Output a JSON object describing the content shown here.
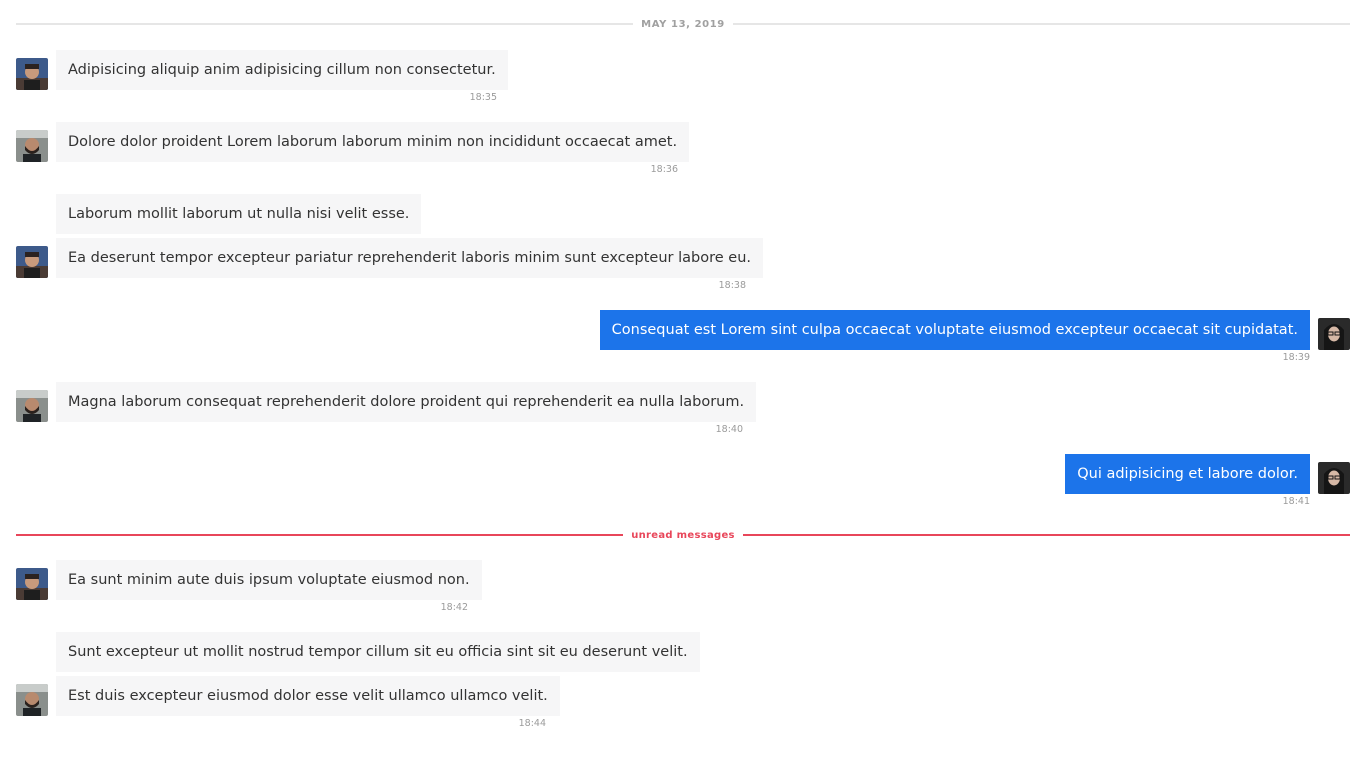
{
  "chat": {
    "date_divider": "MAY 13, 2019",
    "unread_divider": "unread messages",
    "messages": [
      {
        "text": "Adipisicing aliquip anim adipisicing cillum non consectetur.",
        "time": "18:35"
      },
      {
        "text": "Dolore dolor proident Lorem laborum laborum minim non incididunt occaecat amet.",
        "time": "18:36"
      },
      {
        "text": "Laborum mollit laborum ut nulla nisi velit esse."
      },
      {
        "text": "Ea deserunt tempor excepteur pariatur reprehenderit laboris minim sunt excepteur labore eu.",
        "time": "18:38"
      },
      {
        "text": "Consequat est Lorem sint culpa occaecat voluptate eiusmod excepteur occaecat sit cupidatat.",
        "time": "18:39"
      },
      {
        "text": "Magna laborum consequat reprehenderit dolore proident qui reprehenderit ea nulla laborum.",
        "time": "18:40"
      },
      {
        "text": "Qui adipisicing et labore dolor.",
        "time": "18:41"
      },
      {
        "text": "Ea sunt minim aute duis ipsum voluptate eiusmod non.",
        "time": "18:42"
      },
      {
        "text": "Sunt excepteur ut mollit nostrud tempor cillum sit eu officia sint sit eu deserunt velit."
      },
      {
        "text": "Est duis excepteur eiusmod dolor esse velit ullamco ullamco velit.",
        "time": "18:44"
      }
    ]
  },
  "colors": {
    "outgoing_bubble": "#1c74ea",
    "incoming_bubble": "#f6f6f7",
    "unread_accent": "#e8465a"
  }
}
